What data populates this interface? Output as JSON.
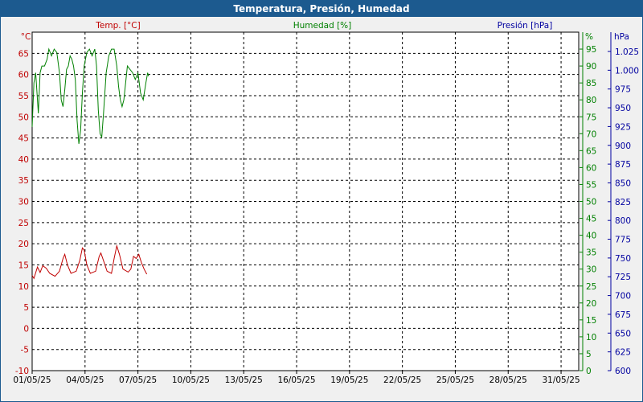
{
  "window": {
    "title": "Temperatura, Presión, Humedad"
  },
  "colors": {
    "temp": "#c00000",
    "hum": "#008000",
    "press": "#0000a0",
    "grid": "#000000",
    "titlebar": "#1c5a8f"
  },
  "chart_data": {
    "type": "line",
    "title": "Temperatura, Presión, Humedad",
    "grid": true,
    "x": {
      "range": [
        "01/05/25",
        "01/06/25"
      ],
      "tick_labels": [
        "01/05/25",
        "04/05/25",
        "07/05/25",
        "10/05/25",
        "13/05/25",
        "16/05/25",
        "19/05/25",
        "22/05/25",
        "25/05/25",
        "28/05/25",
        "31/05/25"
      ]
    },
    "axes": {
      "temp": {
        "label": "Temp. [°C]",
        "unit": "°C",
        "range": [
          -10,
          70
        ],
        "ticks": [
          -10,
          -5,
          0,
          5,
          10,
          15,
          20,
          25,
          30,
          35,
          40,
          45,
          50,
          55,
          60,
          65
        ]
      },
      "hum": {
        "label": "Humedad [%]",
        "unit": "%",
        "range": [
          0,
          100
        ],
        "ticks": [
          0,
          5,
          10,
          15,
          20,
          25,
          30,
          35,
          40,
          45,
          50,
          55,
          60,
          65,
          70,
          75,
          80,
          85,
          90,
          95
        ]
      },
      "press": {
        "label": "Presión [hPa]",
        "unit": "hPa",
        "range": [
          600,
          1050
        ],
        "ticks": [
          "600",
          "625",
          "650",
          "675",
          "700",
          "725",
          "750",
          "775",
          "800",
          "825",
          "850",
          "875",
          "900",
          "925",
          "950",
          "975",
          "1.000",
          "1.025"
        ]
      }
    },
    "series": [
      {
        "name": "Temp. [°C]",
        "axis": "temp",
        "points": [
          [
            0.0,
            12.5
          ],
          [
            0.1,
            11.8
          ],
          [
            0.3,
            14.5
          ],
          [
            0.45,
            13.2
          ],
          [
            0.6,
            14.8
          ],
          [
            0.8,
            14.2
          ],
          [
            1.0,
            13.0
          ],
          [
            1.3,
            12.3
          ],
          [
            1.55,
            13.5
          ],
          [
            1.75,
            16.5
          ],
          [
            1.85,
            17.5
          ],
          [
            2.0,
            15.0
          ],
          [
            2.2,
            13.0
          ],
          [
            2.5,
            13.5
          ],
          [
            2.7,
            16.0
          ],
          [
            2.85,
            19.0
          ],
          [
            2.95,
            18.5
          ],
          [
            3.1,
            15.0
          ],
          [
            3.3,
            13.0
          ],
          [
            3.6,
            13.5
          ],
          [
            3.8,
            17.0
          ],
          [
            3.9,
            17.8
          ],
          [
            4.05,
            16.0
          ],
          [
            4.25,
            13.5
          ],
          [
            4.5,
            13.0
          ],
          [
            4.65,
            16.5
          ],
          [
            4.8,
            19.5
          ],
          [
            4.95,
            17.5
          ],
          [
            5.15,
            14.0
          ],
          [
            5.45,
            13.3
          ],
          [
            5.6,
            14.0
          ],
          [
            5.75,
            17.0
          ],
          [
            5.9,
            16.5
          ],
          [
            6.05,
            17.5
          ],
          [
            6.2,
            15.5
          ],
          [
            6.35,
            14.0
          ],
          [
            6.5,
            12.8
          ]
        ]
      },
      {
        "name": "Humedad [%]",
        "axis": "hum",
        "points": [
          [
            0.0,
            72
          ],
          [
            0.1,
            85
          ],
          [
            0.2,
            88
          ],
          [
            0.3,
            80
          ],
          [
            0.35,
            76
          ],
          [
            0.45,
            88
          ],
          [
            0.55,
            90
          ],
          [
            0.7,
            90
          ],
          [
            0.85,
            92
          ],
          [
            0.95,
            95
          ],
          [
            1.1,
            93
          ],
          [
            1.25,
            95
          ],
          [
            1.4,
            94
          ],
          [
            1.55,
            88
          ],
          [
            1.65,
            80
          ],
          [
            1.75,
            78
          ],
          [
            1.85,
            83
          ],
          [
            1.95,
            89
          ],
          [
            2.05,
            90
          ],
          [
            2.15,
            93
          ],
          [
            2.25,
            92
          ],
          [
            2.35,
            90
          ],
          [
            2.45,
            86
          ],
          [
            2.55,
            74
          ],
          [
            2.65,
            67
          ],
          [
            2.75,
            71
          ],
          [
            2.85,
            82
          ],
          [
            2.95,
            90
          ],
          [
            3.1,
            94
          ],
          [
            3.25,
            95
          ],
          [
            3.4,
            93
          ],
          [
            3.55,
            95
          ],
          [
            3.65,
            90
          ],
          [
            3.75,
            77
          ],
          [
            3.85,
            70
          ],
          [
            3.95,
            69
          ],
          [
            4.05,
            76
          ],
          [
            4.2,
            88
          ],
          [
            4.35,
            93
          ],
          [
            4.5,
            95
          ],
          [
            4.65,
            95
          ],
          [
            4.8,
            90
          ],
          [
            4.9,
            84
          ],
          [
            5.0,
            80
          ],
          [
            5.1,
            78
          ],
          [
            5.2,
            80
          ],
          [
            5.3,
            85
          ],
          [
            5.4,
            90
          ],
          [
            5.55,
            89
          ],
          [
            5.7,
            88
          ],
          [
            5.85,
            86
          ],
          [
            6.0,
            88
          ],
          [
            6.15,
            82
          ],
          [
            6.3,
            80
          ],
          [
            6.45,
            85
          ],
          [
            6.55,
            88
          ],
          [
            6.6,
            87
          ]
        ]
      }
    ]
  }
}
